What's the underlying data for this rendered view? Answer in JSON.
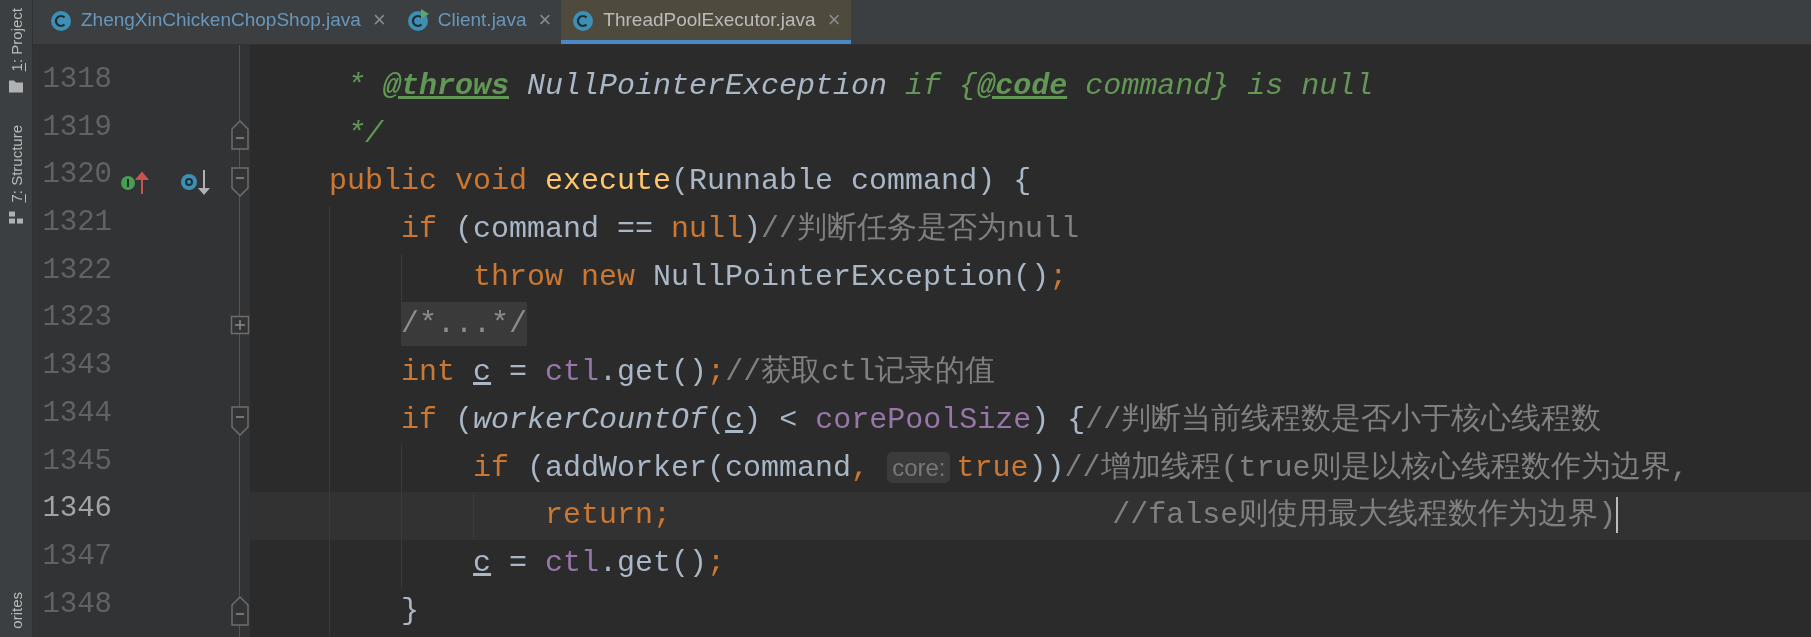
{
  "tool_strip": {
    "top": [
      {
        "mnemonic": "1",
        "label": ": Project",
        "kind": "folder"
      },
      {
        "mnemonic": "7",
        "label": ": Structure",
        "kind": "structure"
      }
    ],
    "bottom": [
      {
        "label": "orites"
      }
    ]
  },
  "tabs": [
    {
      "label": "ZhengXinChickenChopShop.java",
      "kind": "class",
      "vcs_modified": true,
      "selected": false,
      "close": "×"
    },
    {
      "label": "Client.java",
      "kind": "class_run",
      "vcs_modified": true,
      "selected": false,
      "close": "×"
    },
    {
      "label": "ThreadPoolExecutor.java",
      "kind": "class",
      "vcs_modified": false,
      "selected": true,
      "close": "×"
    }
  ],
  "editor": {
    "lines": [
      {
        "number": "1318",
        "kind": "doc",
        "current": false,
        "caret": false,
        "tokens": [
          {
            "text": "* ",
            "kind": "doc"
          },
          {
            "text": "@throws",
            "kind": "doctag"
          },
          {
            "text": " NullPointerException",
            "kind": "doc_ref"
          },
          {
            "text": " if {",
            "kind": "doc"
          },
          {
            "text": "@code",
            "kind": "doctag"
          },
          {
            "text": " command} is null",
            "kind": "doc"
          }
        ]
      },
      {
        "number": "1319",
        "kind": "doc",
        "fold": {
          "kind": "end"
        },
        "current": false,
        "caret": false,
        "tokens": [
          {
            "text": "*/",
            "kind": "doc"
          }
        ]
      },
      {
        "number": "1320",
        "kind": "code",
        "fold": {
          "kind": "start"
        },
        "marks": [
          {
            "kind": "implements"
          },
          {
            "kind": "overridden"
          }
        ],
        "current": false,
        "caret": false,
        "tokens": [
          {
            "text": "public void ",
            "kind": "keyword"
          },
          {
            "text": "execute",
            "kind": "method_decl"
          },
          {
            "text": "(Runnable command) {",
            "kind": "plain"
          }
        ],
        "children": [
          {
            "number": "1321",
            "kind": "code",
            "current": false,
            "caret": false,
            "tokens": [
              {
                "text": "if",
                "kind": "keyword"
              },
              {
                "text": " (command == ",
                "kind": "plain"
              },
              {
                "text": "null",
                "kind": "keyword"
              },
              {
                "text": ")",
                "kind": "plain"
              },
              {
                "text": "//判断任务是否为null",
                "kind": "comment"
              }
            ],
            "children": [
              {
                "number": "1322",
                "kind": "code",
                "current": false,
                "caret": false,
                "tokens": [
                  {
                    "text": "throw new",
                    "kind": "keyword"
                  },
                  {
                    "text": " NullPointerException()",
                    "kind": "plain"
                  },
                  {
                    "text": ";",
                    "kind": "keyword"
                  }
                ]
              }
            ]
          },
          {
            "number": "1323",
            "kind": "code",
            "fold": {
              "kind": "collapsed"
            },
            "current": false,
            "caret": false,
            "tokens": [
              {
                "text": "/*...*/",
                "kind": "folded"
              }
            ]
          },
          {
            "number": "1343",
            "kind": "code",
            "current": false,
            "caret": false,
            "tokens": [
              {
                "text": "int ",
                "kind": "keyword"
              },
              {
                "text": "c",
                "kind": "reassigned"
              },
              {
                "text": " = ",
                "kind": "plain"
              },
              {
                "text": "ctl",
                "kind": "field"
              },
              {
                "text": ".get()",
                "kind": "plain"
              },
              {
                "text": ";",
                "kind": "keyword"
              },
              {
                "text": "//获取ctl记录的值",
                "kind": "comment"
              }
            ]
          },
          {
            "number": "1344",
            "kind": "code",
            "fold": {
              "kind": "start"
            },
            "current": false,
            "caret": false,
            "tokens": [
              {
                "text": "if",
                "kind": "keyword"
              },
              {
                "text": " (",
                "kind": "plain"
              },
              {
                "text": "workerCountOf",
                "kind": "static_call"
              },
              {
                "text": "(",
                "kind": "plain"
              },
              {
                "text": "c",
                "kind": "reassigned"
              },
              {
                "text": ") < ",
                "kind": "plain"
              },
              {
                "text": "corePoolSize",
                "kind": "field"
              },
              {
                "text": ") {",
                "kind": "plain"
              },
              {
                "text": "//判断当前线程数是否小于核心线程数",
                "kind": "comment"
              }
            ],
            "children": [
              {
                "number": "1345",
                "kind": "code",
                "current": false,
                "caret": false,
                "tokens": [
                  {
                    "text": "if",
                    "kind": "keyword"
                  },
                  {
                    "text": " (addWorker(command",
                    "kind": "plain"
                  },
                  {
                    "text": ",",
                    "kind": "keyword"
                  },
                  {
                    "text": "core:",
                    "kind": "hint"
                  },
                  {
                    "text": "true",
                    "kind": "keyword"
                  },
                  {
                    "text": "))",
                    "kind": "plain"
                  },
                  {
                    "text": "//增加线程(true则是以核心线程数作为边界,",
                    "kind": "comment"
                  }
                ],
                "children": [
                  {
                    "number": "1346",
                    "kind": "code",
                    "current": true,
                    "caret": true,
                    "tokens": [
                      {
                        "text": "return",
                        "kind": "keyword"
                      },
                      {
                        "text": ";",
                        "kind": "keyword"
                      },
                      {
                        "text": "//false则使用最大线程数作为边界)",
                        "kind": "aligned_comment"
                      }
                    ]
                  }
                ]
              },
              {
                "number": "1347",
                "kind": "code",
                "current": false,
                "caret": false,
                "tokens": [
                  {
                    "text": "c",
                    "kind": "reassigned"
                  },
                  {
                    "text": " = ",
                    "kind": "plain"
                  },
                  {
                    "text": "ctl",
                    "kind": "field"
                  },
                  {
                    "text": ".get()",
                    "kind": "plain"
                  },
                  {
                    "text": ";",
                    "kind": "keyword"
                  }
                ]
              }
            ]
          },
          {
            "number": "1348",
            "kind": "code",
            "fold": {
              "kind": "end"
            },
            "current": false,
            "caret": false,
            "tokens": [
              {
                "text": "}",
                "kind": "plain"
              }
            ]
          }
        ]
      }
    ]
  }
}
